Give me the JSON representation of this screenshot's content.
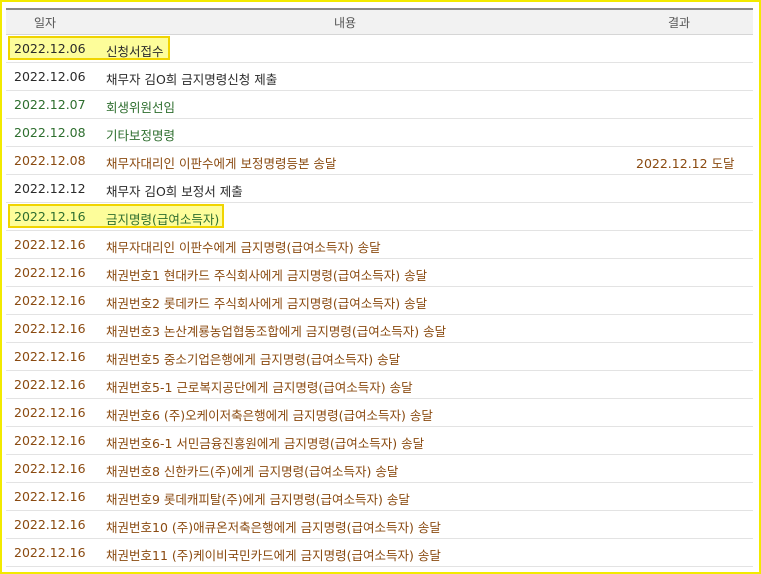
{
  "header": {
    "date": "일자",
    "content": "내용",
    "result": "결과"
  },
  "rows": [
    {
      "date": "2022.12.06",
      "content": "신청서접수",
      "result": "",
      "color": "#2a2a2a"
    },
    {
      "date": "2022.12.06",
      "content": "채무자 김O희 금지명령신청 제출",
      "result": "",
      "color": "#2a2a2a"
    },
    {
      "date": "2022.12.07",
      "content": "회생위원선임",
      "result": "",
      "color": "#2e6e2e"
    },
    {
      "date": "2022.12.08",
      "content": "기타보정명령",
      "result": "",
      "color": "#2e6e2e"
    },
    {
      "date": "2022.12.08",
      "content": "채무자대리인 이판수에게 보정명령등본 송달",
      "result": "2022.12.12 도달",
      "color": "#8a4a10"
    },
    {
      "date": "2022.12.12",
      "content": "채무자 김O희 보정서 제출",
      "result": "",
      "color": "#2a2a2a"
    },
    {
      "date": "2022.12.16",
      "content": "금지명령(급여소득자)",
      "result": "",
      "color": "#2e6e2e"
    },
    {
      "date": "2022.12.16",
      "content": "채무자대리인 이판수에게 금지명령(급여소득자) 송달",
      "result": "",
      "color": "#8a4a10"
    },
    {
      "date": "2022.12.16",
      "content": "채권번호1 현대카드 주식회사에게 금지명령(급여소득자) 송달",
      "result": "",
      "color": "#8a4a10"
    },
    {
      "date": "2022.12.16",
      "content": "채권번호2 롯데카드 주식회사에게 금지명령(급여소득자) 송달",
      "result": "",
      "color": "#8a4a10"
    },
    {
      "date": "2022.12.16",
      "content": "채권번호3 논산계룡농업협동조합에게 금지명령(급여소득자) 송달",
      "result": "",
      "color": "#8a4a10"
    },
    {
      "date": "2022.12.16",
      "content": "채권번호5 중소기업은행에게 금지명령(급여소득자) 송달",
      "result": "",
      "color": "#8a4a10"
    },
    {
      "date": "2022.12.16",
      "content": "채권번호5-1 근로복지공단에게 금지명령(급여소득자) 송달",
      "result": "",
      "color": "#8a4a10"
    },
    {
      "date": "2022.12.16",
      "content": "채권번호6 (주)오케이저축은행에게 금지명령(급여소득자) 송달",
      "result": "",
      "color": "#8a4a10"
    },
    {
      "date": "2022.12.16",
      "content": "채권번호6-1 서민금융진흥원에게 금지명령(급여소득자) 송달",
      "result": "",
      "color": "#8a4a10"
    },
    {
      "date": "2022.12.16",
      "content": "채권번호8 신한카드(주)에게 금지명령(급여소득자) 송달",
      "result": "",
      "color": "#8a4a10"
    },
    {
      "date": "2022.12.16",
      "content": "채권번호9 롯데캐피탈(주)에게 금지명령(급여소득자) 송달",
      "result": "",
      "color": "#8a4a10"
    },
    {
      "date": "2022.12.16",
      "content": "채권번호10 (주)애큐온저축은행에게 금지명령(급여소득자) 송달",
      "result": "",
      "color": "#8a4a10"
    },
    {
      "date": "2022.12.16",
      "content": "채권번호11 (주)케이비국민카드에게 금지명령(급여소득자) 송달",
      "result": "",
      "color": "#8a4a10"
    }
  ],
  "highlighted_rows": [
    0,
    6
  ]
}
